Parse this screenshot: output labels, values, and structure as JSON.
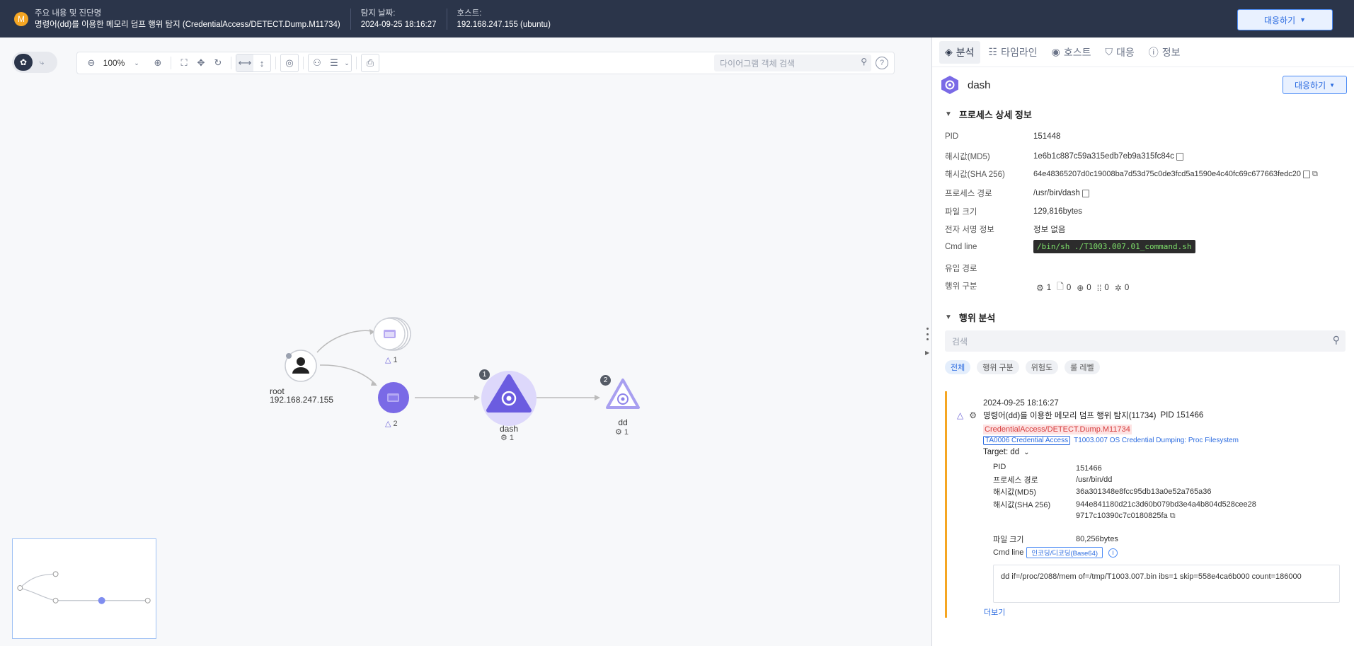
{
  "header": {
    "badge": "M",
    "summary_label": "주요 내용 및 진단명",
    "summary_value": "명령어(dd)를 이용한 메모리 덤프 행위 탐지 (CredentialAccess/DETECT.Dump.M11734)",
    "date_label": "탐지 날짜:",
    "date_value": "2024-09-25 18:16:27",
    "host_label": "호스트:",
    "host_value": "192.168.247.155 (ubuntu)",
    "respond_label": "대응하기"
  },
  "toolbar": {
    "zoom": "100%",
    "search_placeholder": "다이어그램 객체 검색",
    "help": "?"
  },
  "graph": {
    "root_label": "root",
    "root_ip": "192.168.247.155",
    "node_top_count": "1",
    "node_mid_count": "2",
    "dash_label": "dash",
    "dash_count": "1",
    "dash_badge": "1",
    "dd_label": "dd",
    "dd_count": "1",
    "dd_badge": "2"
  },
  "panel": {
    "tabs": [
      {
        "label": "분석",
        "icon": "analysis-icon"
      },
      {
        "label": "타임라인",
        "icon": "timeline-icon"
      },
      {
        "label": "호스트",
        "icon": "host-icon"
      },
      {
        "label": "대응",
        "icon": "shield-icon"
      },
      {
        "label": "정보",
        "icon": "info-icon"
      }
    ],
    "title": "dash",
    "respond_label": "대응하기",
    "process_section": "프로세스 상세 정보",
    "pid_k": "PID",
    "pid_v": "151448",
    "md5_k": "해시값(MD5)",
    "md5_v": "1e6b1c887c59a315edb7eb9a315fc84c",
    "sha_k": "해시값(SHA 256)",
    "sha_v": "64e48365207d0c19008ba7d53d75c0de3fcd5a1590e4c40fc69c677663fedc20",
    "path_k": "프로세스 경로",
    "path_v": "/usr/bin/dash",
    "size_k": "파일 크기",
    "size_v": "129,816bytes",
    "sign_k": "전자 서명 정보",
    "sign_v": "정보 없음",
    "cmd_k": "Cmd line",
    "cmd_v": "/bin/sh ./T1003.007.01_command.sh",
    "inflow_k": "유입 경로",
    "beh_k": "행위 구분",
    "beh_counts": [
      "1",
      "0",
      "0",
      "0",
      "0"
    ],
    "behavior_section": "행위 분석",
    "search_placeholder": "검색",
    "filters": [
      "전체",
      "행위 구분",
      "위험도",
      "룰 레벨"
    ],
    "event": {
      "timestamp": "2024-09-25 18:16:27",
      "title": "명령어(dd)를 이용한 메모리 덤프 행위 탐지(11734)",
      "pid_text": "PID 151466",
      "tag": "CredentialAccess/DETECT.Dump.M11734",
      "tactic": "TA0006 Credential Access",
      "technique": "T1003.007 OS Credential Dumping: Proc Filesystem",
      "target": "Target: dd",
      "pid_k": "PID",
      "pid_v": "151466",
      "path_k": "프로세스 경로",
      "path_v": "/usr/bin/dd",
      "md5_k": "해시값(MD5)",
      "md5_v": "36a301348e8fcc95db13a0e52a765a36",
      "sha_k": "해시값(SHA 256)",
      "sha_v": "944e841180d21c3d60b079bd3e4a4b804d528cee289717c10390c7c0180825fa",
      "size_k": "파일 크기",
      "size_v": "80,256bytes",
      "cmd_k": "Cmd line",
      "enc_label": "인코딩/디코딩(Base64)",
      "cmd_v": "dd if=/proc/2088/mem of=/tmp/T1003.007.bin ibs=1 skip=558e4ca6b000 count=186000",
      "more": "더보기"
    }
  }
}
